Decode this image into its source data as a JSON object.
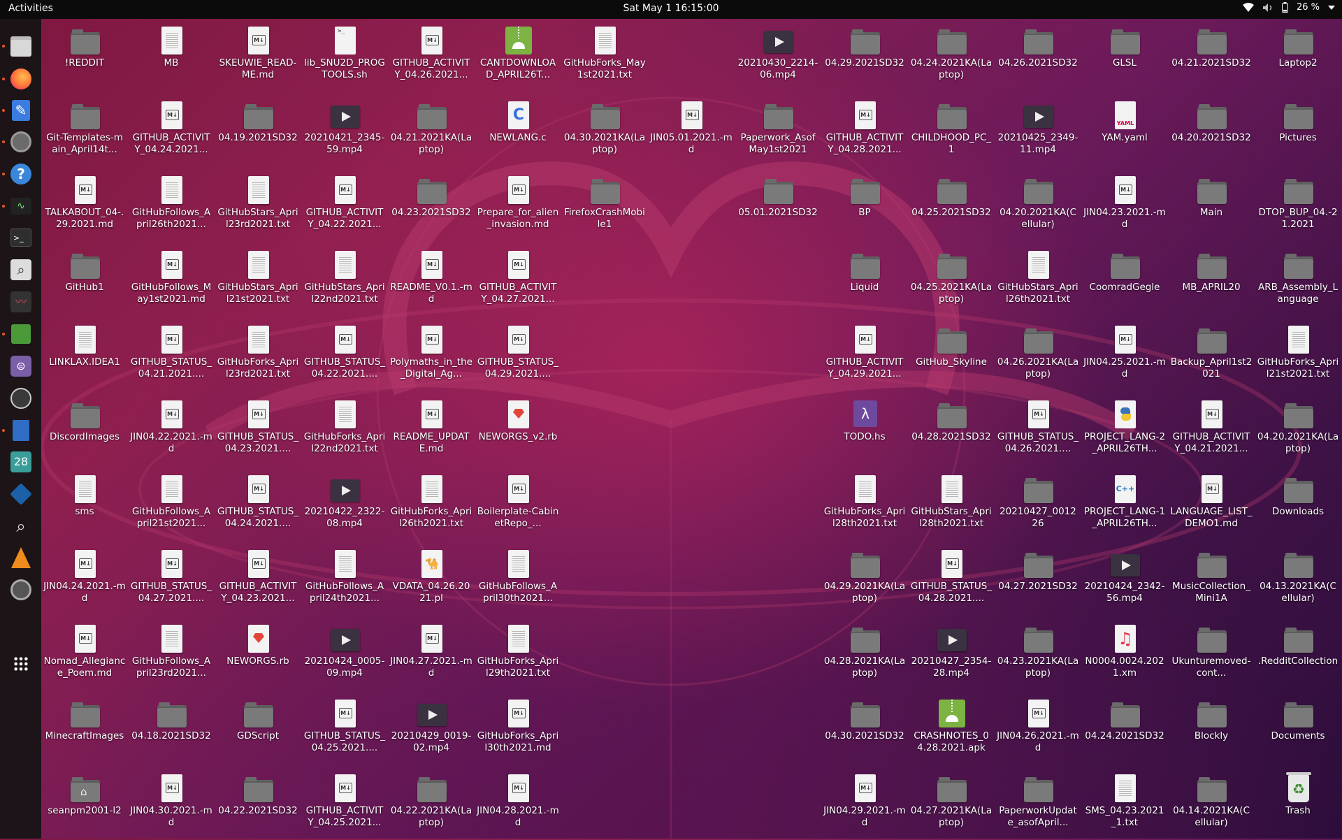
{
  "topbar": {
    "activities": "Activities",
    "clock": "Sat May 1  16:15:00",
    "battery": "26 %"
  },
  "colors": {
    "accent": "#e95420",
    "topbar": "#0b0b0b",
    "folder": "#7a7a7a"
  },
  "dock": {
    "items": [
      {
        "name": "files-icon",
        "running": true
      },
      {
        "name": "firefox-icon",
        "running": true
      },
      {
        "name": "text-editor-icon",
        "running": true
      },
      {
        "name": "settings-icon",
        "running": true
      },
      {
        "name": "help-icon",
        "running": true
      },
      {
        "name": "system-monitor-icon",
        "running": true
      },
      {
        "name": "terminal-icon",
        "running": false
      },
      {
        "name": "search-icon",
        "running": false
      },
      {
        "name": "sound-recorder-icon",
        "running": false
      },
      {
        "name": "extensions-icon",
        "running": true
      },
      {
        "name": "tweaks-icon",
        "running": false
      },
      {
        "name": "clock-icon",
        "running": false
      },
      {
        "name": "document-viewer-icon",
        "running": true
      },
      {
        "name": "calendar-icon",
        "running": false,
        "text": "28"
      },
      {
        "name": "virtualbox-icon",
        "running": false
      },
      {
        "name": "magnifier-icon",
        "running": false
      },
      {
        "name": "vlc-icon",
        "running": false
      },
      {
        "name": "screenshot-icon",
        "running": false
      },
      {
        "name": "show-apps-icon",
        "running": false
      }
    ]
  },
  "desktop": {
    "columns": [
      [
        {
          "label": "!REDDIT",
          "type": "folder"
        },
        {
          "label": "Git-Templates-main_April14t...",
          "type": "folder"
        },
        {
          "label": "TALKABOUT_04-.29.2021.md",
          "type": "md"
        },
        {
          "label": "GitHub1",
          "type": "folder"
        },
        {
          "label": "LINKLAX.IDEA1",
          "type": "txt"
        },
        {
          "label": "DiscordImages",
          "type": "folder"
        },
        {
          "label": "sms",
          "type": "txt"
        },
        {
          "label": "JIN04.24.2021.-md",
          "type": "md"
        },
        {
          "label": "Nomad_Allegiance_Poem.md",
          "type": "md"
        },
        {
          "label": "MinecraftImages",
          "type": "folder"
        },
        {
          "label": "seanpm2001-l2",
          "type": "home"
        }
      ],
      [
        {
          "label": "MB",
          "type": "txt"
        },
        {
          "label": "GITHUB_ACTIVITY_04.24.2021...",
          "type": "md"
        },
        {
          "label": "GitHubFollows_April26th2021...",
          "type": "txt"
        },
        {
          "label": "GitHubFollows_May1st2021.md",
          "type": "md"
        },
        {
          "label": "GITHUB_STATUS_04.21.2021....",
          "type": "md"
        },
        {
          "label": "JIN04.22.2021.-md",
          "type": "md"
        },
        {
          "label": "GitHubFollows_April21st2021...",
          "type": "txt"
        },
        {
          "label": "GITHUB_STATUS_04.27.2021....",
          "type": "md"
        },
        {
          "label": "GitHubFollows_April23rd2021...",
          "type": "txt"
        },
        {
          "label": "04.18.2021SD32",
          "type": "folder"
        },
        {
          "label": "JIN04.30.2021.-md",
          "type": "md"
        }
      ],
      [
        {
          "label": "SKEUWIE_READ-ME.md",
          "type": "md"
        },
        {
          "label": "04.19.2021SD32",
          "type": "folder"
        },
        {
          "label": "GitHubStars_April23rd2021.txt",
          "type": "txt"
        },
        {
          "label": "GitHubStars_April21st2021.txt",
          "type": "txt"
        },
        {
          "label": "GitHubForks_April23rd2021.txt",
          "type": "txt"
        },
        {
          "label": "GITHUB_STATUS_04.23.2021....",
          "type": "md"
        },
        {
          "label": "GITHUB_STATUS_04.24.2021....",
          "type": "md"
        },
        {
          "label": "GITHUB_ACTIVITY_04.23.2021...",
          "type": "md"
        },
        {
          "label": "NEWORGS.rb",
          "type": "ruby"
        },
        {
          "label": "GDScript",
          "type": "folder"
        },
        {
          "label": "04.22.2021SD32",
          "type": "folder"
        }
      ],
      [
        {
          "label": "lib_SNU2D_PROGTOOLS.sh",
          "type": "script"
        },
        {
          "label": "20210421_2345-59.mp4",
          "type": "video"
        },
        {
          "label": "GITHUB_ACTIVITY_04.22.2021...",
          "type": "md"
        },
        {
          "label": "GitHubStars_April22nd2021.txt",
          "type": "txt"
        },
        {
          "label": "GITHUB_STATUS_04.22.2021....",
          "type": "md"
        },
        {
          "label": "GitHubForks_April22nd2021.txt",
          "type": "txt"
        },
        {
          "label": "20210422_2322-08.mp4",
          "type": "video"
        },
        {
          "label": "GitHubFollows_April24th2021...",
          "type": "txt"
        },
        {
          "label": "20210424_0005-09.mp4",
          "type": "video"
        },
        {
          "label": "GITHUB_STATUS_04.25.2021....",
          "type": "md"
        },
        {
          "label": "GITHUB_ACTIVITY_04.25.2021...",
          "type": "md"
        }
      ],
      [
        {
          "label": "GITHUB_ACTIVITY_04.26.2021...",
          "type": "md"
        },
        {
          "label": "04.21.2021KA(Laptop)",
          "type": "folder"
        },
        {
          "label": "04.23.2021SD32",
          "type": "folder"
        },
        {
          "label": "README_V0.1.-md",
          "type": "md"
        },
        {
          "label": "Polymaths_in_the_Digital_Ag...",
          "type": "md"
        },
        {
          "label": "README_UPDATE.md",
          "type": "md"
        },
        {
          "label": "GitHubForks_April26th2021.txt",
          "type": "txt"
        },
        {
          "label": "VDATA_04.26.2021.pl",
          "type": "perl"
        },
        {
          "label": "JIN04.27.2021.-md",
          "type": "md"
        },
        {
          "label": "20210429_0019-02.mp4",
          "type": "video"
        },
        {
          "label": "04.22.2021KA(Laptop)",
          "type": "folder"
        }
      ],
      [
        {
          "label": "CANTDOWNLOAD_APRIL26T...",
          "type": "apk"
        },
        {
          "label": "NEWLANG.c",
          "type": "c"
        },
        {
          "label": "Prepare_for_alien_invasion.md",
          "type": "md"
        },
        {
          "label": "GITHUB_ACTIVITY_04.27.2021...",
          "type": "md"
        },
        {
          "label": "GITHUB_STATUS_04.29.2021....",
          "type": "md"
        },
        {
          "label": "NEWORGS_v2.rb",
          "type": "ruby"
        },
        {
          "label": "Boilerplate-CabinetRepo_...",
          "type": "md"
        },
        {
          "label": "GitHubFollows_April30th2021...",
          "type": "txt"
        },
        {
          "label": "GitHubForks_April29th2021.txt",
          "type": "txt"
        },
        {
          "label": "GitHubForks_April30th2021.md",
          "type": "md"
        },
        {
          "label": "JIN04.28.2021.-md",
          "type": "md"
        }
      ],
      [
        {
          "label": "GitHubForks_May1st2021.txt",
          "type": "txt"
        },
        {
          "label": "04.30.2021KA(Laptop)",
          "type": "folder"
        },
        {
          "label": "FirefoxCrashMobile1",
          "type": "folder"
        },
        null,
        null,
        null,
        null,
        null,
        null,
        null,
        null
      ],
      [
        null,
        {
          "label": "JIN05.01.2021.-md",
          "type": "md"
        },
        null,
        null,
        null,
        null,
        null,
        null,
        null,
        null,
        null
      ],
      [
        {
          "label": "20210430_2214-06.mp4",
          "type": "video"
        },
        {
          "label": "Paperwork_AsofMay1st2021",
          "type": "folder"
        },
        {
          "label": "05.01.2021SD32",
          "type": "folder"
        },
        null,
        null,
        null,
        null,
        null,
        null,
        null,
        null
      ],
      [
        {
          "label": "04.29.2021SD32",
          "type": "folder"
        },
        {
          "label": "GITHUB_ACTIVITY_04.28.2021...",
          "type": "md"
        },
        {
          "label": "BP",
          "type": "folder"
        },
        {
          "label": "Liquid",
          "type": "folder"
        },
        {
          "label": "GITHUB_ACTIVITY_04.29.2021...",
          "type": "md"
        },
        {
          "label": "TODO.hs",
          "type": "haskell"
        },
        {
          "label": "GitHubForks_April28th2021.txt",
          "type": "txt"
        },
        {
          "label": "04.29.2021KA(Laptop)",
          "type": "folder"
        },
        {
          "label": "04.28.2021KA(Laptop)",
          "type": "folder"
        },
        {
          "label": "04.30.2021SD32",
          "type": "folder"
        },
        {
          "label": "JIN04.29.2021.-md",
          "type": "md"
        }
      ],
      [
        {
          "label": "04.24.2021KA(Laptop)",
          "type": "folder"
        },
        {
          "label": "CHILDHOOD_PC_1",
          "type": "folder"
        },
        {
          "label": "04.25.2021SD32",
          "type": "folder"
        },
        {
          "label": "04.25.2021KA(Laptop)",
          "type": "folder"
        },
        {
          "label": "GitHub_Skyline",
          "type": "folder"
        },
        {
          "label": "04.28.2021SD32",
          "type": "folder"
        },
        {
          "label": "GitHubStars_April28th2021.txt",
          "type": "txt"
        },
        {
          "label": "GITHUB_STATUS_04.28.2021....",
          "type": "md"
        },
        {
          "label": "20210427_2354-28.mp4",
          "type": "video"
        },
        {
          "label": "CRASHNOTES_04.28.2021.apk",
          "type": "apk"
        },
        {
          "label": "04.27.2021KA(Laptop)",
          "type": "folder"
        }
      ],
      [
        {
          "label": "04.26.2021SD32",
          "type": "folder"
        },
        {
          "label": "20210425_2349-11.mp4",
          "type": "video"
        },
        {
          "label": "04.20.2021KA(Cellular)",
          "type": "folder"
        },
        {
          "label": "GitHubStars_April26th2021.txt",
          "type": "txt"
        },
        {
          "label": "04.26.2021KA(Laptop)",
          "type": "folder"
        },
        {
          "label": "GITHUB_STATUS_04.26.2021....",
          "type": "md"
        },
        {
          "label": "20210427_001226",
          "type": "folder"
        },
        {
          "label": "04.27.2021SD32",
          "type": "folder"
        },
        {
          "label": "04.23.2021KA(Laptop)",
          "type": "folder"
        },
        {
          "label": "JIN04.26.2021.-md",
          "type": "md"
        },
        {
          "label": "PaperworkUpdate_asofApril...",
          "type": "folder"
        }
      ],
      [
        {
          "label": "GLSL",
          "type": "folder"
        },
        {
          "label": "YAM.yaml",
          "type": "yaml"
        },
        {
          "label": "JIN04.23.2021.-md",
          "type": "md"
        },
        {
          "label": "CoomradGegle",
          "type": "folder"
        },
        {
          "label": "JIN04.25.2021.-md",
          "type": "md"
        },
        {
          "label": "PROJECT_LANG-2_APRIL26TH...",
          "type": "python"
        },
        {
          "label": "PROJECT_LANG-1_APRIL26TH...",
          "type": "cpp"
        },
        {
          "label": "20210424_2342-56.mp4",
          "type": "video"
        },
        {
          "label": "N0004.0024.2021.xm",
          "type": "music"
        },
        {
          "label": "04.24.2021SD32",
          "type": "folder"
        },
        {
          "label": "SMS_04.23.2021_1.txt",
          "type": "txt"
        }
      ],
      [
        {
          "label": "04.21.2021SD32",
          "type": "folder"
        },
        {
          "label": "04.20.2021SD32",
          "type": "folder"
        },
        {
          "label": "Main",
          "type": "folder"
        },
        {
          "label": "MB_APRIL20",
          "type": "folder"
        },
        {
          "label": "Backup_April1st2021",
          "type": "folder"
        },
        {
          "label": "GITHUB_ACTIVITY_04.21.2021...",
          "type": "md"
        },
        {
          "label": "LANGUAGE_LIST_DEMO1.md",
          "type": "md"
        },
        {
          "label": "MusicCollection_Mini1A",
          "type": "folder"
        },
        {
          "label": "Ukunturemoved-cont...",
          "type": "folder"
        },
        {
          "label": "Blockly",
          "type": "folder"
        },
        {
          "label": "04.14.2021KA(Cellular)",
          "type": "folder"
        }
      ],
      [
        {
          "label": "Laptop2",
          "type": "folder"
        },
        {
          "label": "Pictures",
          "type": "folder"
        },
        {
          "label": "DTOP_BUP_04.-21.2021",
          "type": "folder"
        },
        {
          "label": "ARB_Assembly_Language",
          "type": "folder"
        },
        {
          "label": "GitHubForks_April21st2021.txt",
          "type": "txt"
        },
        {
          "label": "04.20.2021KA(Laptop)",
          "type": "folder"
        },
        {
          "label": "Downloads",
          "type": "folder"
        },
        {
          "label": "04.13.2021KA(Cellular)",
          "type": "folder"
        },
        {
          "label": ".RedditCollection",
          "type": "folder"
        },
        {
          "label": "Documents",
          "type": "folder"
        },
        {
          "label": "Trash",
          "type": "trash"
        }
      ]
    ]
  }
}
